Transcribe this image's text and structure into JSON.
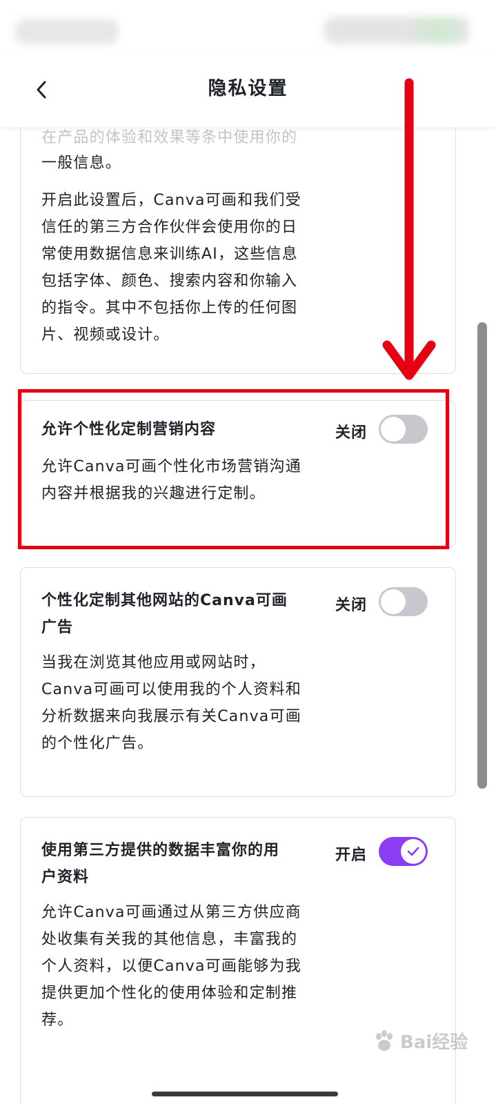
{
  "header": {
    "title": "隐私设置",
    "back_icon": "chevron-left-icon"
  },
  "card_ai": {
    "faded_line": "在产品的体验和效果等条中使用你的",
    "lines_top": [
      "一般信息。"
    ],
    "body_lines": [
      "开启此设置后，Canva可画和我们受",
      "信任的第三方合作伙伴会使用你的日",
      "常使用数据信息来训练AI，这些信息",
      "包括字体、颜色、搜索内容和你输入",
      "的指令。其中不包括你上传的任何图",
      "片、视频或设计。"
    ]
  },
  "card_marketing": {
    "title": "允许个性化定制营销内容",
    "status": "关闭",
    "enabled": false,
    "desc_lines": [
      "允许Canva可画个性化市场营销沟通",
      "内容并根据我的兴趣进行定制。"
    ]
  },
  "card_ads": {
    "title_lines": [
      "个性化定制其他网站的Canva可画",
      "广告"
    ],
    "status": "关闭",
    "enabled": false,
    "desc_lines": [
      "当我在浏览其他应用或网站时，",
      "Canva可画可以使用我的个人资料和",
      "分析数据来向我展示有关Canva可画",
      "的个性化广告。"
    ]
  },
  "card_thirdparty": {
    "title_lines": [
      "使用第三方提供的数据丰富你的用",
      "户资料"
    ],
    "status": "开启",
    "enabled": true,
    "desc_lines": [
      "允许Canva可画通过从第三方供应商",
      "处收集有关我的其他信息，丰富我的",
      "个人资料，以便Canva可画能够为我",
      "提供更加个性化的使用体验和定制推",
      "荐。"
    ]
  },
  "watermark": {
    "text": "Bai经验"
  },
  "colors": {
    "accent": "#8b3cf5",
    "toggle_off": "#c6c8cd",
    "highlight": "#e60012"
  }
}
